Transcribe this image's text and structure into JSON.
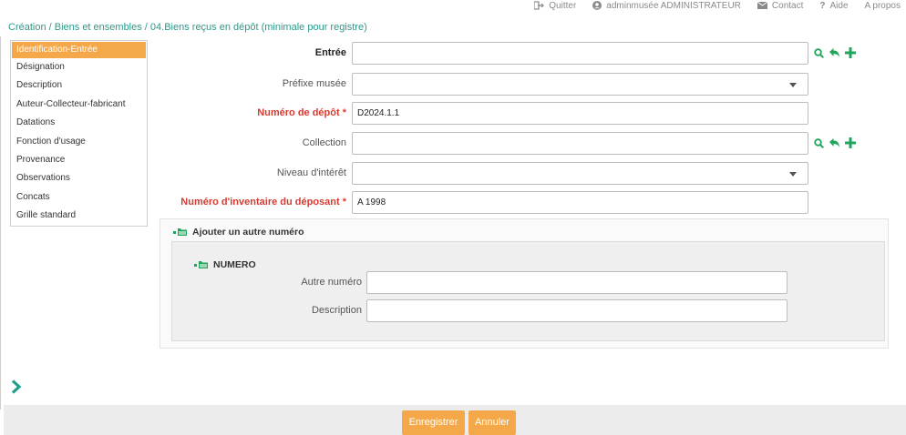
{
  "topbar": {
    "quit_label": "Quitter",
    "user_label": "adminmusée ADMINISTRATEUR",
    "contact_label": "Contact",
    "help_label": "Aide",
    "about_label": "A propos"
  },
  "breadcrumb": "Création / Biens et ensembles / 04.Biens reçus en dépôt (minimale pour registre)",
  "sidebar": {
    "items": [
      {
        "label": "Identification-Entrée",
        "active": true
      },
      {
        "label": "Désignation"
      },
      {
        "label": "Description"
      },
      {
        "label": "Auteur-Collecteur-fabricant"
      },
      {
        "label": "Datations"
      },
      {
        "label": "Fonction d'usage"
      },
      {
        "label": "Provenance"
      },
      {
        "label": "Observations"
      },
      {
        "label": "Concats"
      },
      {
        "label": "Grille standard"
      }
    ]
  },
  "form": {
    "entree": {
      "label": "Entrée",
      "value": ""
    },
    "prefixe": {
      "label": "Préfixe musée",
      "value": ""
    },
    "numero_depot": {
      "label": "Numéro de dépôt *",
      "value": "D2024.1.1"
    },
    "collection": {
      "label": "Collection",
      "value": ""
    },
    "niveau": {
      "label": "Niveau d'intérêt",
      "value": ""
    },
    "numero_inventaire": {
      "label": "Numéro d'inventaire du déposant *",
      "value": "A 1998"
    }
  },
  "panel": {
    "title": "Ajouter un autre numéro",
    "inner_title": "NUMERO",
    "autre_numero": {
      "label": "Autre numéro",
      "value": ""
    },
    "description": {
      "label": "Description",
      "value": ""
    }
  },
  "footer": {
    "save_label": "Enregistrer",
    "cancel_label": "Annuler"
  },
  "colors": {
    "accent": "#f5a84a",
    "teal": "#2a9a8a",
    "green_icon": "#22a55a",
    "required": "#d63b32"
  }
}
